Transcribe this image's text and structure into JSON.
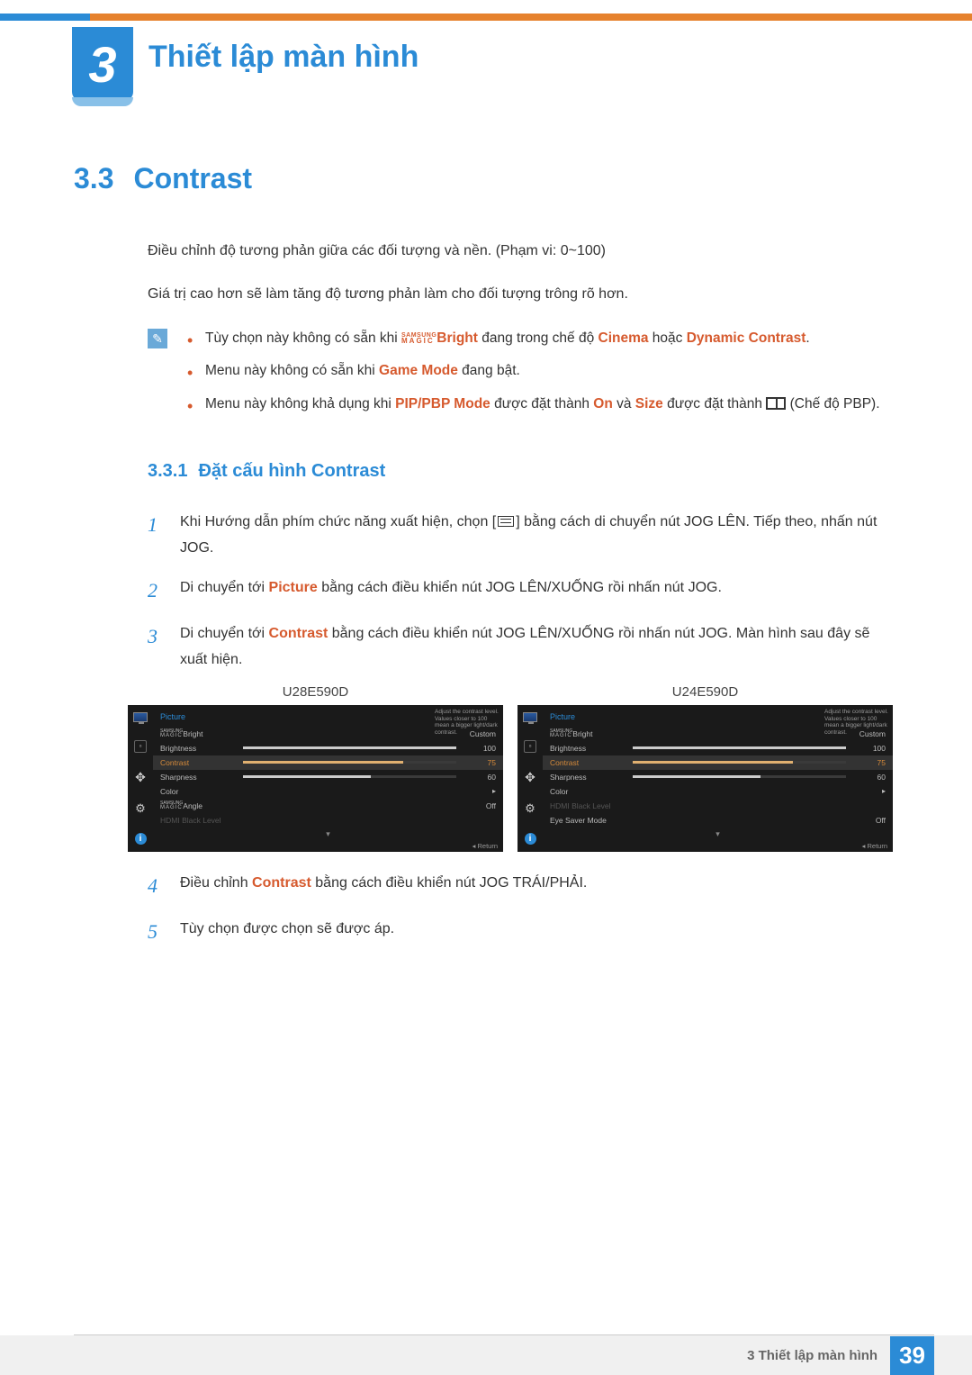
{
  "chapter": {
    "number": "3",
    "title": "Thiết lập màn hình"
  },
  "section": {
    "number": "3.3",
    "title": "Contrast"
  },
  "paragraphs": {
    "p1": "Điều chỉnh độ tương phản giữa các đối tượng và nền. (Phạm vi: 0~100)",
    "p2": "Giá trị cao hơn sẽ làm tăng độ tương phản làm cho đối tượng trông rõ hơn."
  },
  "notes": {
    "n1_pre": "Tùy chọn này không có sẵn khi ",
    "n1_bright": "Bright",
    "n1_mid": " đang trong chế độ ",
    "n1_cinema": "Cinema",
    "n1_or": " hoặc ",
    "n1_dc": "Dynamic Contrast",
    "n1_post": ".",
    "n2_pre": "Menu này không có sẵn khi ",
    "n2_gm": "Game Mode",
    "n2_post": " đang bật.",
    "n3_pre": "Menu này không khả dụng khi ",
    "n3_pip": "PIP/PBP Mode",
    "n3_mid1": " được đặt thành ",
    "n3_on": "On",
    "n3_mid2": " và ",
    "n3_size": "Size",
    "n3_mid3": " được đặt thành ",
    "n3_post": " (Chế độ PBP)."
  },
  "subsection": {
    "number": "3.3.1",
    "title": "Đặt cấu hình Contrast"
  },
  "steps": {
    "s1a": "Khi Hướng dẫn phím chức năng xuất hiện, chọn [",
    "s1b": "] bằng cách di chuyển nút JOG LÊN. Tiếp theo, nhấn nút JOG.",
    "s2a": "Di chuyển tới ",
    "s2_picture": "Picture",
    "s2b": " bằng cách điều khiển nút JOG LÊN/XUỐNG rồi nhấn nút JOG.",
    "s3a": "Di chuyển tới ",
    "s3_contrast": "Contrast",
    "s3b": " bằng cách điều khiển nút JOG LÊN/XUỐNG rồi nhấn nút JOG. Màn hình sau đây sẽ xuất hiện.",
    "s4a": "Điều chỉnh ",
    "s4_contrast": "Contrast",
    "s4b": " bằng cách điều khiển nút JOG TRÁI/PHẢI.",
    "s5": "Tùy chọn được chọn sẽ được áp."
  },
  "osd": {
    "models": {
      "left": "U28E590D",
      "right": "U24E590D"
    },
    "title": "Picture",
    "tip": "Adjust the contrast level. Values closer to 100 mean a bigger light/dark contrast.",
    "return": "Return",
    "magic": {
      "top": "SAMSUNG",
      "bottom": "MAGIC"
    },
    "left_items": [
      {
        "label_suffix": "Bright",
        "val": "Custom",
        "magic": true
      },
      {
        "label": "Brightness",
        "val": "100",
        "bar": 100
      },
      {
        "label": "Contrast",
        "val": "75",
        "bar": 75,
        "sel": true
      },
      {
        "label": "Sharpness",
        "val": "60",
        "bar": 60
      },
      {
        "label": "Color",
        "arrow": "▸"
      },
      {
        "label_suffix": "Angle",
        "val": "Off",
        "magic": true
      },
      {
        "label": "HDMI Black Level",
        "dim": true
      }
    ],
    "right_items": [
      {
        "label_suffix": "Bright",
        "val": "Custom",
        "magic": true
      },
      {
        "label": "Brightness",
        "val": "100",
        "bar": 100
      },
      {
        "label": "Contrast",
        "val": "75",
        "bar": 75,
        "sel": true
      },
      {
        "label": "Sharpness",
        "val": "60",
        "bar": 60
      },
      {
        "label": "Color",
        "arrow": "▸"
      },
      {
        "label": "HDMI Black Level",
        "dim": true
      },
      {
        "label": "Eye Saver Mode",
        "val": "Off"
      }
    ]
  },
  "footer": {
    "text": "3 Thiết lập màn hình",
    "page": "39"
  }
}
